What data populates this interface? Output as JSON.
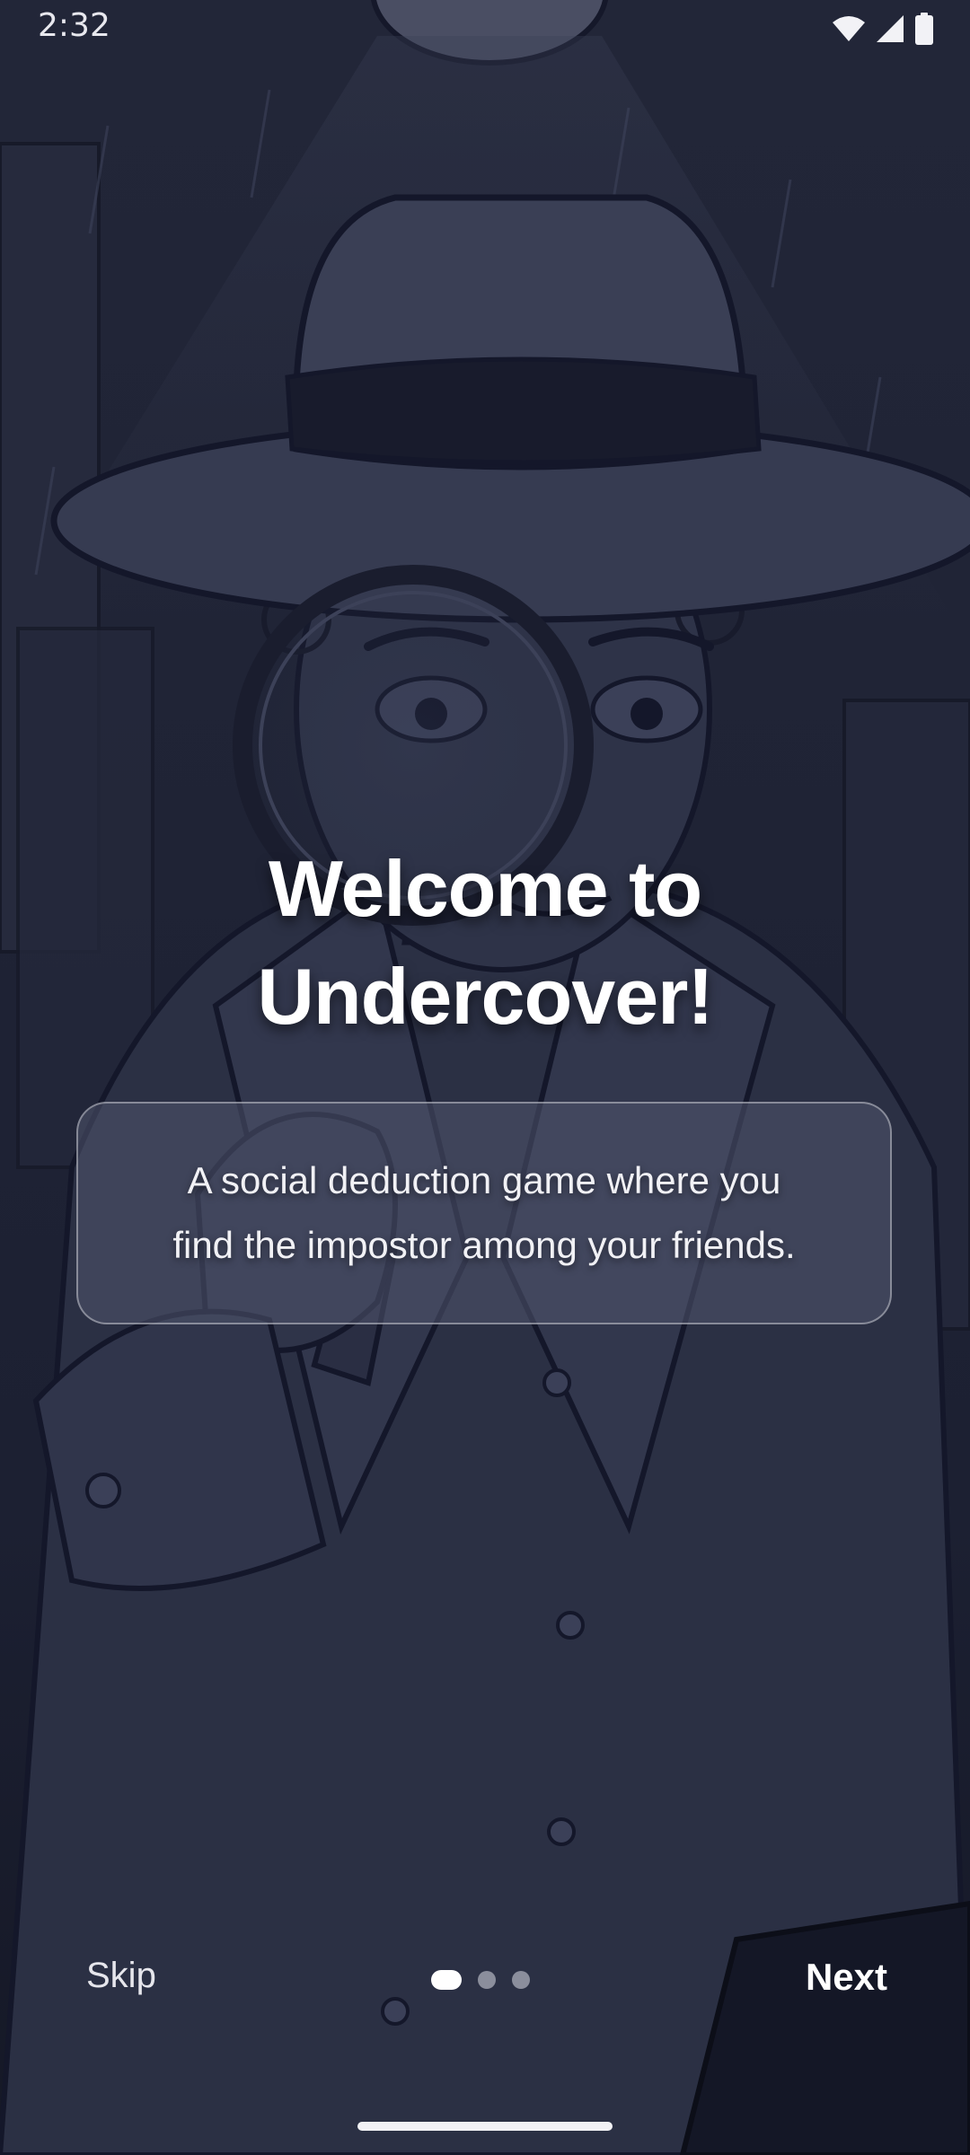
{
  "status_bar": {
    "time": "2:32",
    "icons": [
      "wifi-icon",
      "signal-icon",
      "battery-icon"
    ]
  },
  "onboarding": {
    "title_line1": "Welcome to",
    "title_line2": "Undercover!",
    "description_line1": "A social deduction game where you",
    "description_line2": "find the impostor among your friends.",
    "page_index": 1,
    "page_count": 3
  },
  "navigation": {
    "skip_label": "Skip",
    "next_label": "Next"
  },
  "colors": {
    "background": "#1e2233",
    "text": "#ffffff",
    "card_border": "#9aa0b4",
    "dot_inactive": "#8b8e9c"
  }
}
